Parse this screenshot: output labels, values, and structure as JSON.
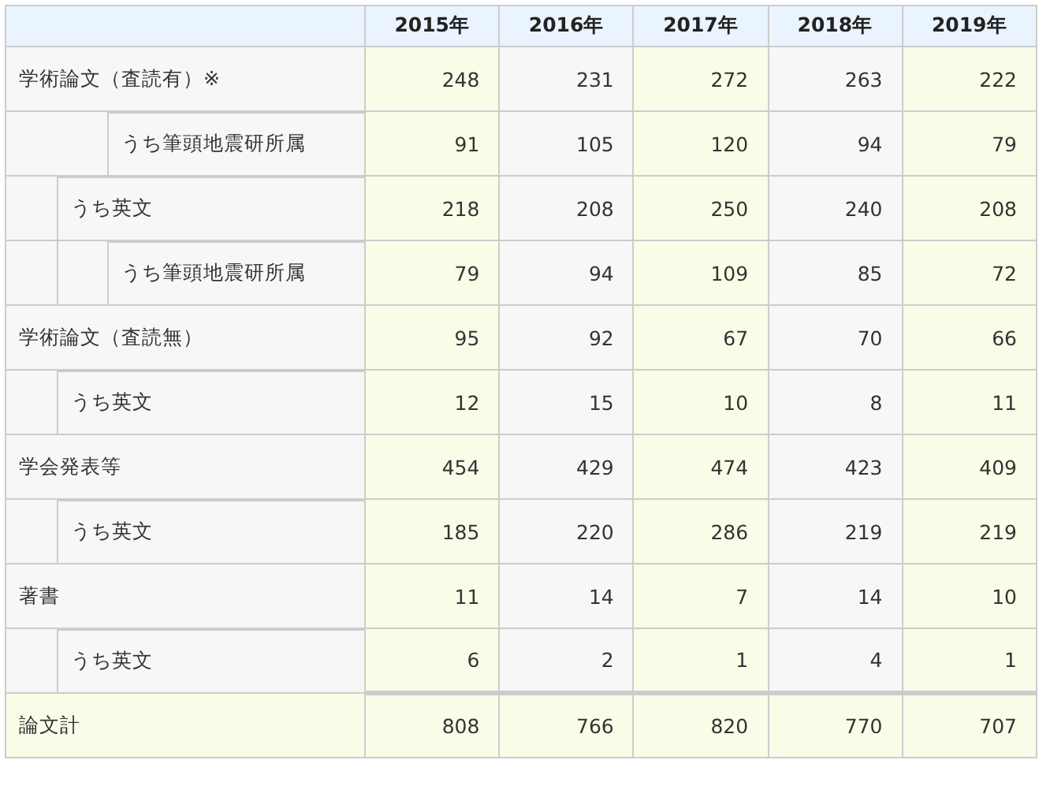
{
  "table": {
    "columns": [
      "2015年",
      "2016年",
      "2017年",
      "2018年",
      "2019年"
    ],
    "rows": [
      {
        "label": "学術論文（査読有）※",
        "kind": "category",
        "values": [
          "248",
          "231",
          "272",
          "263",
          "222"
        ],
        "children": [
          {
            "label": "うち筆頭地震研所属",
            "kind": "author",
            "values": [
              "91",
              "105",
              "120",
              "94",
              "79"
            ]
          },
          {
            "label": "うち英文",
            "kind": "english",
            "values": [
              "218",
              "208",
              "250",
              "240",
              "208"
            ],
            "children": [
              {
                "label": "うち筆頭地震研所属",
                "kind": "author",
                "values": [
                  "79",
                  "94",
                  "109",
                  "85",
                  "72"
                ]
              }
            ]
          }
        ]
      },
      {
        "label": "学術論文（査読無）",
        "kind": "category",
        "values": [
          "95",
          "92",
          "67",
          "70",
          "66"
        ],
        "children": [
          {
            "label": "うち英文",
            "kind": "english",
            "values": [
              "12",
              "15",
              "10",
              "8",
              "11"
            ]
          }
        ]
      },
      {
        "label": "学会発表等",
        "kind": "category",
        "values": [
          "454",
          "429",
          "474",
          "423",
          "409"
        ],
        "children": [
          {
            "label": "うち英文",
            "kind": "english",
            "values": [
              "185",
              "220",
              "286",
              "219",
              "219"
            ]
          }
        ]
      },
      {
        "label": "著書",
        "kind": "category",
        "values": [
          "11",
          "14",
          "7",
          "14",
          "10"
        ],
        "children": [
          {
            "label": "うち英文",
            "kind": "english",
            "values": [
              "6",
              "2",
              "1",
              "4",
              "1"
            ]
          }
        ]
      },
      {
        "label": "論文計",
        "kind": "total",
        "values": [
          "808",
          "766",
          "820",
          "770",
          "707"
        ]
      }
    ]
  }
}
